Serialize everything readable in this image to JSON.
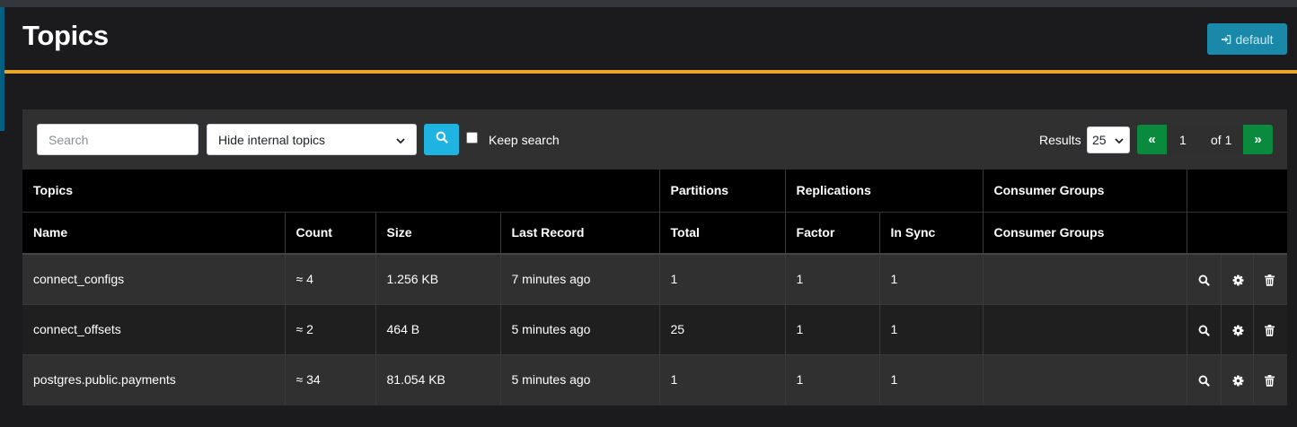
{
  "header": {
    "title": "Topics",
    "cluster_button": "default",
    "cluster_icon": "sign-in-icon",
    "accent_color": "#e8a729",
    "button_color": "#1a88a8"
  },
  "toolbar": {
    "search_placeholder": "Search",
    "filter_selected": "Hide internal topics",
    "search_icon": "search-icon",
    "keep_search_label": "Keep search",
    "keep_search_checked": false
  },
  "pagination": {
    "results_label": "Results",
    "page_size": "25",
    "prev": "«",
    "current_page": "1",
    "of_label": "of 1",
    "next": "»",
    "pager_color": "#0a8a3c"
  },
  "table": {
    "groups": [
      "Topics",
      "Partitions",
      "Replications",
      "Consumer Groups",
      ""
    ],
    "columns": [
      "Name",
      "Count",
      "Size",
      "Last Record",
      "Total",
      "Factor",
      "In Sync",
      "Consumer Groups"
    ],
    "rows": [
      {
        "name": "connect_configs",
        "count": "≈ 4",
        "size": "1.256 KB",
        "last_record": "7 minutes ago",
        "total": "1",
        "factor": "1",
        "in_sync": "1",
        "consumer_groups": ""
      },
      {
        "name": "connect_offsets",
        "count": "≈ 2",
        "size": "464 B",
        "last_record": "5 minutes ago",
        "total": "25",
        "factor": "1",
        "in_sync": "1",
        "consumer_groups": ""
      },
      {
        "name": "postgres.public.payments",
        "count": "≈ 34",
        "size": "81.054 KB",
        "last_record": "5 minutes ago",
        "total": "1",
        "factor": "1",
        "in_sync": "1",
        "consumer_groups": ""
      }
    ],
    "row_actions": [
      "search-icon",
      "gear-icon",
      "trash-icon"
    ]
  }
}
